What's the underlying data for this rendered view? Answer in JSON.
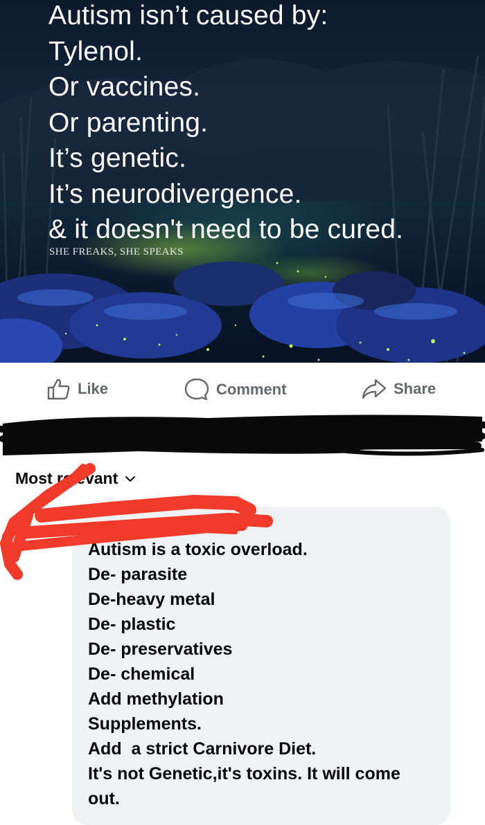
{
  "post": {
    "image_lines": [
      "Autism isn’t caused by:",
      "Tylenol.",
      "Or vaccines.",
      "Or parenting.",
      "It’s genetic.",
      "It’s neurodivergence.",
      "& it doesn't need to be cured."
    ],
    "watermark": "SHE FREAKS, SHE SPEAKS"
  },
  "actions": {
    "like": "Like",
    "comment": "Comment",
    "share": "Share"
  },
  "comments": {
    "sort_label": "Most relevant"
  },
  "comment": {
    "lines": [
      "Autism is a toxic overload.",
      "De- parasite",
      "De-heavy metal",
      "De- plastic",
      "De- preservatives",
      "De- chemical",
      "Add methylation",
      "Supplements.",
      "Add  a strict Carnivore Diet.",
      "It's not Genetic,it's toxins. It will come",
      "out."
    ]
  },
  "colors": {
    "action_text": "#65676b",
    "bubble": "#eff1f3",
    "redaction": "#0a0a0a",
    "scribble": "#f03a2a"
  }
}
